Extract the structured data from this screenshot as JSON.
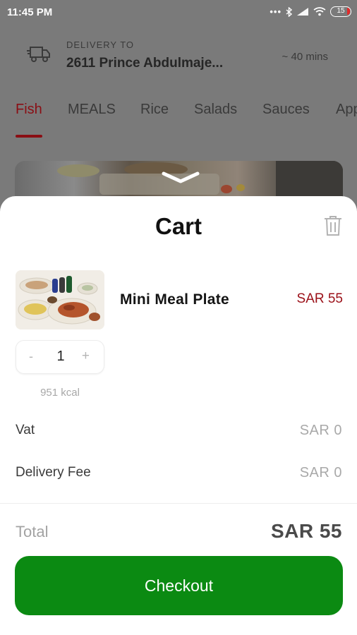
{
  "status_bar": {
    "time": "11:45 PM",
    "icons": [
      "more-dots-icon",
      "bluetooth-icon",
      "signal-icon",
      "wifi-icon",
      "battery-icon"
    ],
    "battery_level": "15"
  },
  "header": {
    "delivery_label": "DELIVERY TO",
    "address": "2611 Prince Abdulmaje...",
    "eta": "~ 40 mins",
    "icon": "delivery-truck-icon"
  },
  "tabs": [
    {
      "label": "Fish",
      "active": true
    },
    {
      "label": "MEALS",
      "active": false
    },
    {
      "label": "Rice",
      "active": false
    },
    {
      "label": "Salads",
      "active": false
    },
    {
      "label": "Sauces",
      "active": false
    },
    {
      "label": "App",
      "active": false
    }
  ],
  "cart": {
    "title": "Cart",
    "item": {
      "name": "Mini Meal Plate",
      "price": "SAR 55",
      "quantity": "1",
      "minus_label": "-",
      "plus_label": "+",
      "kcal": "951 kcal"
    },
    "summary": {
      "vat_label": "Vat",
      "vat_value": "SAR 0",
      "delivery_fee_label": "Delivery Fee",
      "delivery_fee_value": "SAR 0",
      "total_label": "Total",
      "total_value": "SAR 55"
    },
    "checkout_label": "Checkout"
  },
  "colors": {
    "accent_red": "#9b1018",
    "checkout_green": "#0b8a12",
    "overlay_gray": "#7a7a7a"
  }
}
